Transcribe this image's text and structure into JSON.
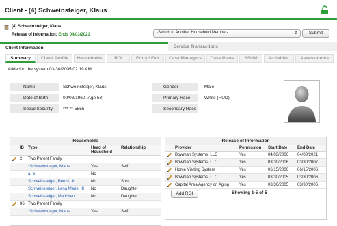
{
  "header": {
    "title": "Client - (4) Schweinsteiger, Klaus"
  },
  "client_bar": {
    "name": "(4) Schweinsteiger, Klaus",
    "roi_label": "Release of Information:",
    "roi_value": "Ends 04/03/2021",
    "household_select": "-Switch to Another Household Member-",
    "submit_label": "Submit"
  },
  "main_tabs": [
    {
      "label": "Client Information",
      "active": true
    },
    {
      "label": "Service Transactions",
      "active": false
    }
  ],
  "sub_tabs": [
    "Summary",
    "Client Profile",
    "Households",
    "ROI",
    "Entry / Exit",
    "Case Managers",
    "Case Plans",
    "SSOM",
    "Activities",
    "Assessments"
  ],
  "added_text": "Added to the system 03/30/2005 02:19 AM",
  "info_left": [
    {
      "label": "Name",
      "value": "Schweinsteiger, Klaus"
    },
    {
      "label": "Date of Birth",
      "value": "09/08/1960 (Age 53)"
    },
    {
      "label": "Social Security",
      "value": "***-**-5555"
    }
  ],
  "info_right": [
    {
      "label": "Gender",
      "value": "Male"
    },
    {
      "label": "Primary Race",
      "value": "White (HUD)"
    },
    {
      "label": "Secondary Race",
      "value": ""
    }
  ],
  "households": {
    "title": "Households",
    "columns": [
      "ID",
      "Type",
      "Head of Household",
      "Relationship"
    ],
    "rows": [
      {
        "id": "2",
        "type": "Two Parent Family",
        "head": "",
        "rel": "",
        "edit": true,
        "link": false
      },
      {
        "id": "",
        "type": "*Schweinsteiger, Klaus",
        "head": "Yes",
        "rel": "Self",
        "edit": false,
        "link": true
      },
      {
        "id": "",
        "type": "a, a",
        "head": "No",
        "rel": "",
        "edit": false,
        "link": true
      },
      {
        "id": "",
        "type": "Schweinsteiger, Bernd, Jr.",
        "head": "No",
        "rel": "Son",
        "edit": false,
        "link": true
      },
      {
        "id": "",
        "type": "Schweinsteiger, Lena Marie, III",
        "head": "No",
        "rel": "Daughter",
        "edit": false,
        "link": true
      },
      {
        "id": "",
        "type": "Schweinsteiger, Madchen",
        "head": "No",
        "rel": "Daughter",
        "edit": false,
        "link": true
      },
      {
        "id": "86",
        "type": "Two Parent Family",
        "head": "",
        "rel": "",
        "edit": true,
        "link": false
      },
      {
        "id": "",
        "type": "*Schweinsteiger, Klaus",
        "head": "Yes",
        "rel": "Self",
        "edit": false,
        "link": true
      }
    ]
  },
  "roi": {
    "title": "Release of Information",
    "columns": [
      "Provider",
      "Permission",
      "Start Date",
      "End Date"
    ],
    "rows": [
      {
        "provider": "Bowman Systems, LLC",
        "permission": "Yes",
        "start": "04/03/2006",
        "end": "04/03/2021"
      },
      {
        "provider": "Bowman Systems, LLC",
        "permission": "Yes",
        "start": "03/30/2006",
        "end": "03/30/2007"
      },
      {
        "provider": "Home Visiting System",
        "permission": "Yes",
        "start": "06/15/2006",
        "end": "06/15/2006"
      },
      {
        "provider": "Bowman Systems, LLC",
        "permission": "Yes",
        "start": "03/30/2005",
        "end": "03/30/2006"
      },
      {
        "provider": "Capital Area Agency on Aging",
        "permission": "Yes",
        "start": "03/30/2005",
        "end": "03/30/2006"
      }
    ],
    "add_label": "Add ROI",
    "showing": "Showing 1-5 of 5"
  },
  "colors": {
    "accent": "#2e9e3a",
    "link": "#2a5db0"
  }
}
